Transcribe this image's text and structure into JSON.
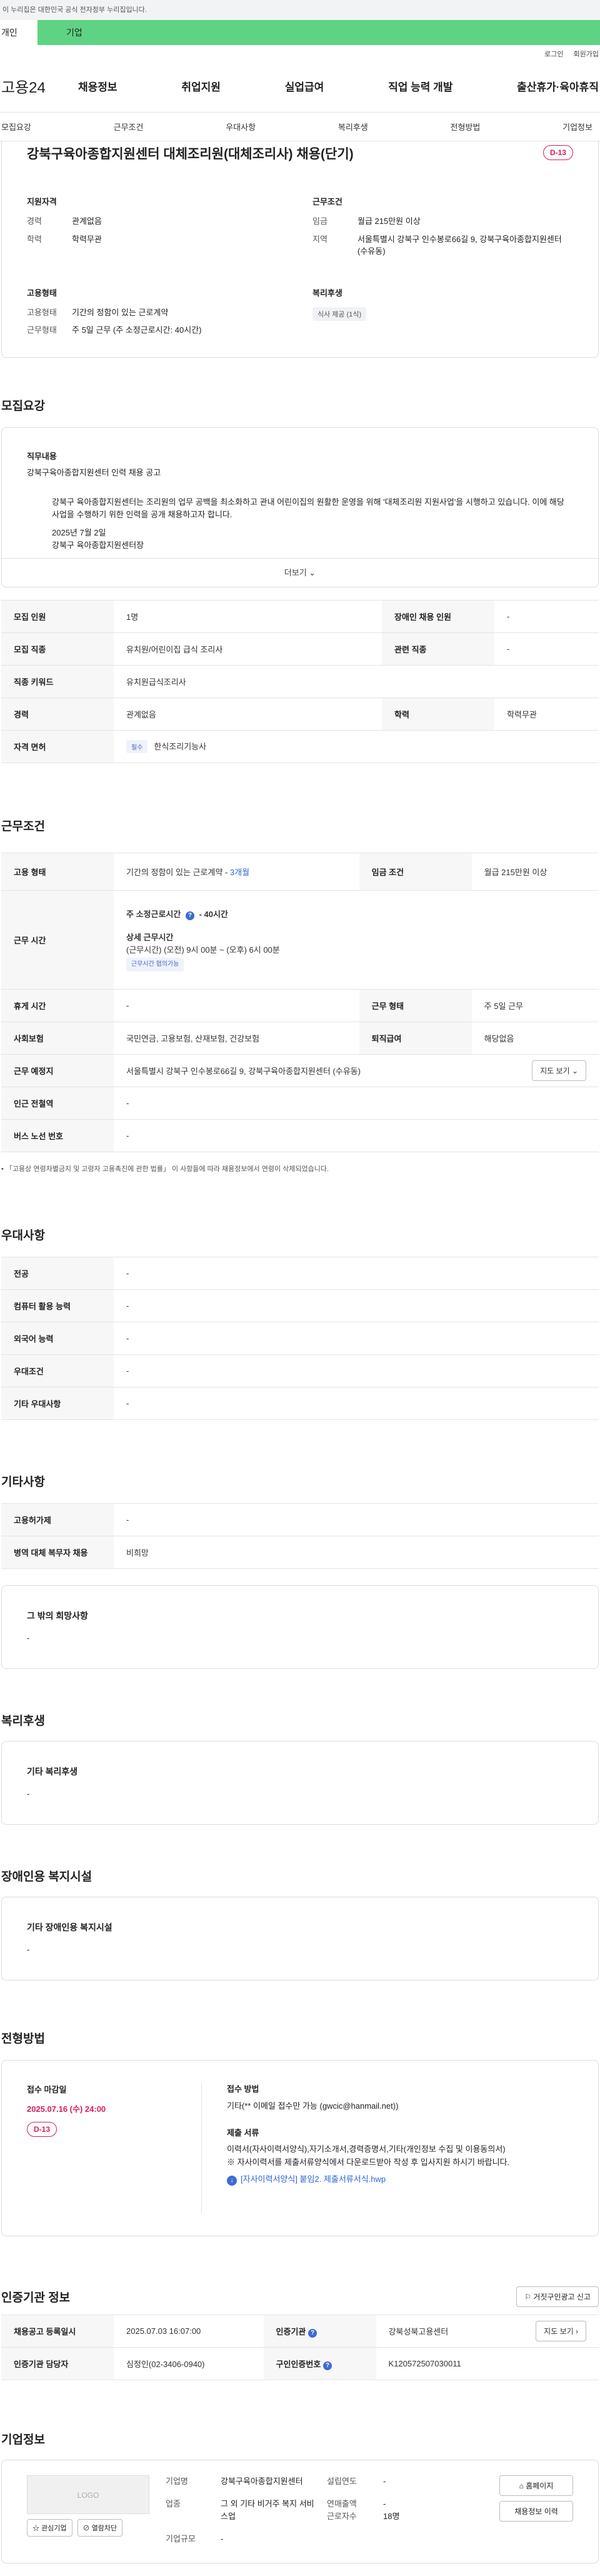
{
  "gov_banner": "이 누리집은 대한민국 공식 전자정부 누리집입니다.",
  "user_tabs": [
    "개인",
    "기업"
  ],
  "util_links": [
    "로그인",
    "회원가입"
  ],
  "logo": "고용24",
  "gnb": [
    "채용정보",
    "취업지원",
    "실업급여",
    "직업 능력 개발",
    "출산휴가·육아휴직"
  ],
  "subtabs": [
    "모집요강",
    "근무조건",
    "우대사항",
    "복리후생",
    "전형방법",
    "기업정보"
  ],
  "job": {
    "title": "강북구육아종합지원센터 대체조리원(대체조리사) 채용(단기)",
    "dday": "D-13",
    "qual_title": "지원자격",
    "qual": [
      {
        "k": "경력",
        "v": "관계없음"
      },
      {
        "k": "학력",
        "v": "학력무관"
      }
    ],
    "cond_title": "근무조건",
    "cond": [
      {
        "k": "임금",
        "v": "월급 215만원 이상"
      },
      {
        "k": "지역",
        "v": "서울특별시 강북구 인수봉로66길 9, 강북구육아종합지원센터 (수유동)"
      }
    ],
    "type_title": "고용형태",
    "type": [
      {
        "k": "고용형태",
        "v": "기간의 정함이 있는 근로계약"
      },
      {
        "k": "근무형태",
        "v": "주 5일 근무 (주 소정근로시간: 40시간)"
      }
    ],
    "welfare_title": "복리후생",
    "welfare_badge": "식사 제공 (1식)"
  },
  "s1": {
    "title": "모집요강",
    "desc_head": "직무내용",
    "desc_lines": [
      "강북구육아종합지원센터 인력 채용 공고",
      "",
      "강북구 육아종합지원센터는 조리원의 업무 공백을 최소화하고 관내 어린이집의 원활한 운영을 위해 '대체조리원 지원사업'을 시행하고 있습니다. 이에 해당 사업을 수행하기 위한 인력을 공개 채용하고자 합니다.",
      "",
      "2025년 7월 2일",
      "강북구 육아종합지원센터장"
    ],
    "more": "더보기",
    "rows": [
      {
        "h": "모집 인원",
        "v": "1명",
        "h2": "장애인 채용 인원",
        "v2": "-"
      },
      {
        "h": "모집 직종",
        "v": "유치원/어린이집 급식 조리사",
        "h2": "관련 직종",
        "v2": "-"
      },
      {
        "h": "직종 키워드",
        "v": "유치원급식조리사",
        "h2": "",
        "v2": ""
      },
      {
        "h": "경력",
        "v": "관계없음",
        "h2": "학력",
        "v2": "학력무관"
      }
    ],
    "license_h": "자격 면허",
    "license_tag": "필수",
    "license_v": "한식조리기능사"
  },
  "s2": {
    "title": "근무조건",
    "r1": {
      "h": "고용 형태",
      "v": "기간의 정함이 있는 근로계약 - ",
      "v_link": "3개월",
      "h2": "임금 조건",
      "v2": "월급 215만원 이상"
    },
    "r2": {
      "h": "근무 시간",
      "week": "주 소정근로시간 ",
      "week_b": "40시간",
      "detail_h": "상세 근무시간",
      "detail": "(근무시간) (오전) 9시 00분 ~ (오후) 6시 00분",
      "tag": "근무시간 협의가능"
    },
    "r3": {
      "h": "휴게 시간",
      "v": "-",
      "h2": "근무 형태",
      "v2": "주 5일 근무"
    },
    "r4": {
      "h": "사회보험",
      "v": "국민연금, 고용보험, 산재보험, 건강보험",
      "h2": "퇴직급여",
      "v2": "해당없음"
    },
    "r5": {
      "h": "근무 예정지",
      "v": "서울특별시 강북구 인수봉로66길 9, 강북구육아종합지원센터 (수유동)",
      "btn": "지도 보기"
    },
    "r6": {
      "h": "인근 전철역",
      "v": "-"
    },
    "r7": {
      "h": "버스 노선 번호",
      "v": "-"
    },
    "note": "「고용상 연령차별금지 및 고령자 고용촉진에 관한 법률」 이 사항들에 따라 채용정보에서 연령이 삭제되었습니다."
  },
  "s3": {
    "title": "우대사항",
    "rows": [
      {
        "h": "전공",
        "v": "-"
      },
      {
        "h": "컴퓨터 활용 능력",
        "v": "-"
      },
      {
        "h": "외국어 능력",
        "v": "-"
      },
      {
        "h": "우대조건",
        "v": "-"
      },
      {
        "h": "기타 우대사항",
        "v": "-"
      }
    ]
  },
  "s4": {
    "title": "기타사항",
    "rows": [
      {
        "h": "고용허가제",
        "v": "-"
      },
      {
        "h": "병역 대체 복무자 채용",
        "v": "비희망"
      }
    ],
    "box_h": "그 밖의 희망사항",
    "box_v": "-"
  },
  "s5": {
    "title": "복리후생",
    "box_h": "기타 복리후생",
    "box_v": "-"
  },
  "s6": {
    "title": "장애인용 복지시설",
    "box_h": "기타 장애인용 복지시설",
    "box_v": "-"
  },
  "s7": {
    "title": "전형방법",
    "deadline_h": "접수 마감일",
    "deadline_v": "2025.07.16 (수) 24:00",
    "dday": "D-13",
    "method_h": "접수 방법",
    "method_v": "기타(** 이메일 접수만 가능 (gwcic@hanmail.net))",
    "docs_h": "제출 서류",
    "docs_v1": "이력서(자사이력서양식),자기소개서,경력증명서,기타(개인정보 수집 및 이용동의서)",
    "docs_v2": "※ 자사이력서를 제출서류양식에서 다운로드받아 작성 후 입사지원 하시기 바랍니다.",
    "file": "[자사이력서양식] 붙임2. 제출서류서식.hwp"
  },
  "s8": {
    "title": "인증기관 정보",
    "btn_report": "거짓구인광고 신고",
    "r1": {
      "h": "채용공고 등록일시",
      "v": "2025.07.03 16:07:00",
      "h2": "인증기관",
      "v2": "강북성북고용센터",
      "btn": "지도 보기"
    },
    "r2": {
      "h": "인증기관 담당자",
      "v": "심정인(02-3406-0940)",
      "h2": "구인인증번호",
      "v2": "K120572507030011"
    }
  },
  "s9": {
    "title": "기업정보",
    "logo": "LOGO",
    "btn_fav": "관심기업",
    "btn_block": "열람차단",
    "name_h": "기업명",
    "name_v": "강북구육아종합지원센터",
    "founded_h": "설립연도",
    "founded_v": "-",
    "ind_h": "업종",
    "ind_v": "그 외 기타 비거주 복지 서비스업",
    "sales_h": "연매출액",
    "sales_v": "-",
    "emp_h": "근로자수",
    "emp_v": "18명",
    "size_h": "기업규모",
    "size_v": "-",
    "btn_home": "홈페이지",
    "btn_jobs": "채용정보 이력"
  }
}
